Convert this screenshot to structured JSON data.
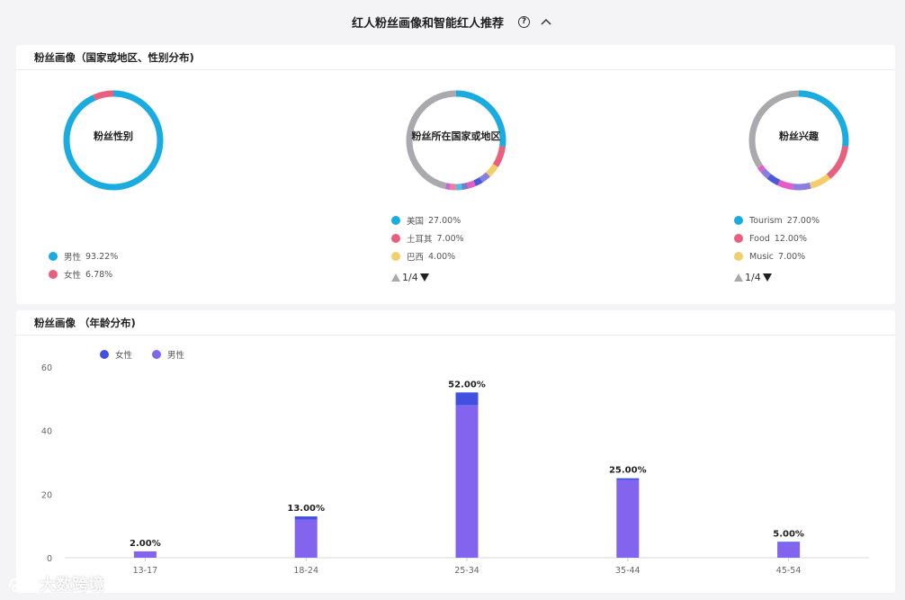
{
  "header": {
    "title": "红人粉丝画像和智能红人推荐"
  },
  "card1": {
    "title": "粉丝画像（国家或地区、性别分布)",
    "gender": {
      "label": "粉丝性别",
      "slices": [
        {
          "name": "男性",
          "value": "93.22%",
          "pct": 93.22,
          "color": "#1aabe0"
        },
        {
          "name": "女性",
          "value": "6.78%",
          "pct": 6.78,
          "color": "#e8607f"
        }
      ]
    },
    "country": {
      "label": "粉丝所在国家或地区",
      "slices": [
        {
          "name": "美国",
          "value": "27.00%",
          "pct": 27,
          "color": "#1aabe0"
        },
        {
          "name": "土耳其",
          "value": "7.00%",
          "pct": 7,
          "color": "#e8607f"
        },
        {
          "name": "巴西",
          "value": "4.00%",
          "pct": 4,
          "color": "#f3cf6b"
        }
      ],
      "others": [
        {
          "pct": 3,
          "color": "#8a7fe0"
        },
        {
          "pct": 2.5,
          "color": "#4a5bd6"
        },
        {
          "pct": 2.5,
          "color": "#e85ac8"
        },
        {
          "pct": 2,
          "color": "#7a7ac8"
        },
        {
          "pct": 2,
          "color": "#48c0e6"
        },
        {
          "pct": 2,
          "color": "#f07a9a"
        },
        {
          "pct": 1.5,
          "color": "#c868d8"
        },
        {
          "pct": 46.5,
          "color": "#a9a9ae"
        }
      ],
      "pager": "1/4"
    },
    "interest": {
      "label": "粉丝兴趣",
      "slices": [
        {
          "name": "Tourism",
          "value": "27.00%",
          "pct": 27,
          "color": "#1aabe0"
        },
        {
          "name": "Food",
          "value": "12.00%",
          "pct": 12,
          "color": "#e8607f"
        },
        {
          "name": "Music",
          "value": "7.00%",
          "pct": 7,
          "color": "#f3cf6b"
        }
      ],
      "others": [
        {
          "pct": 6,
          "color": "#8a7fe0"
        },
        {
          "pct": 5,
          "color": "#e85ac8"
        },
        {
          "pct": 4,
          "color": "#4a5bd6"
        },
        {
          "pct": 3,
          "color": "#8a7fe0"
        },
        {
          "pct": 1.5,
          "color": "#e85ac8"
        },
        {
          "pct": 34.5,
          "color": "#a9a9ae"
        }
      ],
      "pager": "1/4"
    }
  },
  "card2": {
    "title": "粉丝画像 （年龄分布)"
  },
  "chart_data": {
    "type": "bar",
    "stacked": true,
    "categories": [
      "13-17",
      "18-24",
      "25-34",
      "35-44",
      "45-54"
    ],
    "series": [
      {
        "name": "女性",
        "values": [
          0,
          1,
          4,
          0.6,
          0.3
        ],
        "color": "#4150e0"
      },
      {
        "name": "男性",
        "values": [
          2,
          12,
          48,
          24.4,
          4.7
        ],
        "color": "#8264ee"
      }
    ],
    "labels": [
      "2.00%",
      "13.00%",
      "52.00%",
      "25.00%",
      "5.00%"
    ],
    "yticks": [
      0,
      20,
      40,
      60
    ],
    "ylim": [
      0,
      60
    ],
    "legend": "top-left",
    "grid": false
  },
  "watermark": {
    "text": "大数跨境"
  }
}
